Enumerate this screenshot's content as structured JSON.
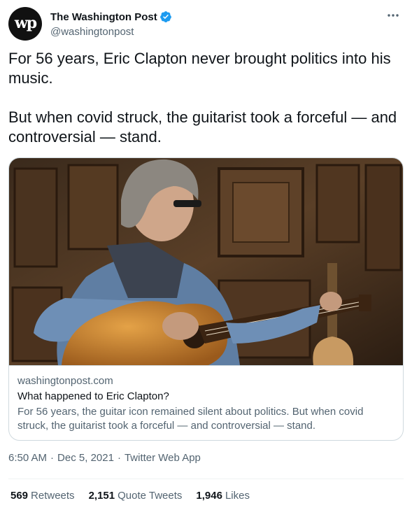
{
  "account": {
    "display_name": "The Washington Post",
    "handle": "@washingtonpost",
    "avatar_text": "wp",
    "verified": true
  },
  "tweet": {
    "text": "For 56 years, Eric Clapton never brought politics into his music.\n\nBut when covid struck, the guitarist took a forceful — and controversial — stand."
  },
  "card": {
    "domain": "washingtonpost.com",
    "title": "What happened to Eric Clapton?",
    "description": "For 56 years, the guitar icon remained silent about politics. But when covid struck, the guitarist took a forceful — and controversial — stand."
  },
  "meta": {
    "time": "6:50 AM",
    "date": "Dec 5, 2021",
    "source": "Twitter Web App",
    "separator": "·"
  },
  "stats": [
    {
      "count": "569",
      "label": "Retweets"
    },
    {
      "count": "2,151",
      "label": "Quote Tweets"
    },
    {
      "count": "1,946",
      "label": "Likes"
    }
  ],
  "colors": {
    "verified_blue": "#1d9bf0",
    "secondary_text": "#536471",
    "border": "#cfd9de"
  }
}
